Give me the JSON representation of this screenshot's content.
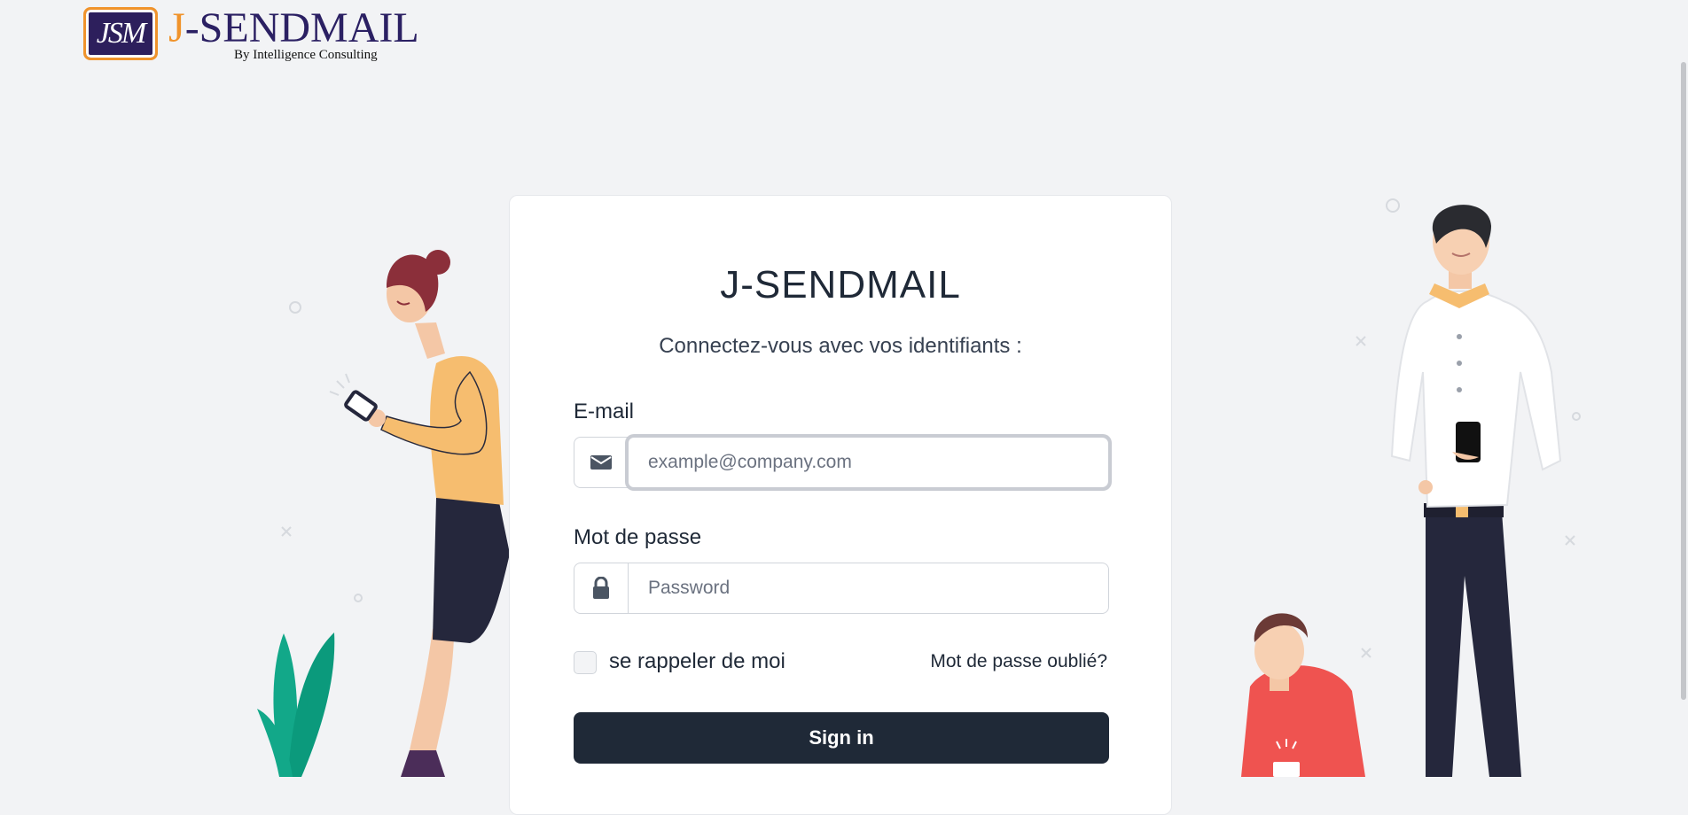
{
  "header": {
    "logo_mark": "JSM",
    "brand_j": "J",
    "brand_rest": "-SENDMAIL",
    "tagline": "By Intelligence Consulting"
  },
  "card": {
    "title": "J-SENDMAIL",
    "subtitle": "Connectez-vous avec vos identifiants :",
    "email_label": "E-mail",
    "email_placeholder": "example@company.com",
    "email_value": "",
    "password_label": "Mot de passe",
    "password_placeholder": "Password",
    "password_value": "",
    "remember_label": "se rappeler de moi",
    "forgot_label": "Mot de passe oublié?",
    "signin_label": "Sign in"
  },
  "icons": {
    "email": "envelope-icon",
    "password": "lock-icon"
  },
  "colors": {
    "accent": "#f0932b",
    "brand": "#2b2063",
    "button": "#1f2937",
    "background": "#f2f3f5"
  }
}
